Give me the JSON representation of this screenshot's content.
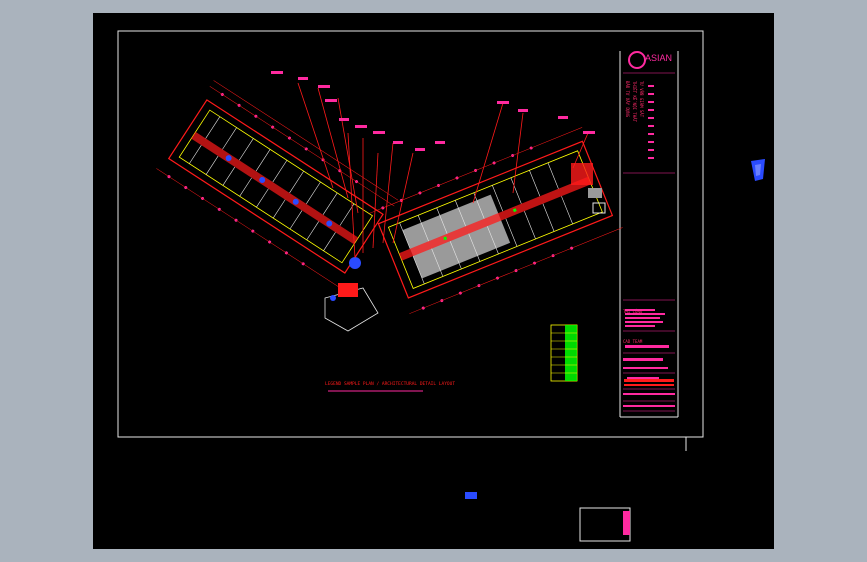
{
  "titleblock": {
    "logo_text": "ASIAN",
    "notes": [
      "ĐẦU TƯ XÂY DỰNG",
      "THIẾT KẾ NỘI THẤT",
      "TƯ VẤN GIÁM SÁT",
      "THI CÔNG",
      "CAD TEAM"
    ]
  },
  "drawing": {
    "caption": "LEGEND SAMPLE PLAN / ARCHITECTURAL DETAIL LAYOUT"
  },
  "colors": {
    "background": "#000000",
    "frame": "#e6e6e6",
    "primary_line": "#ff1a1a",
    "magenta": "#ff2aa0",
    "yellow": "#ffff00",
    "blue": "#2a4bff",
    "gray_fill": "#9a9a9a",
    "green": "#00ff00"
  }
}
